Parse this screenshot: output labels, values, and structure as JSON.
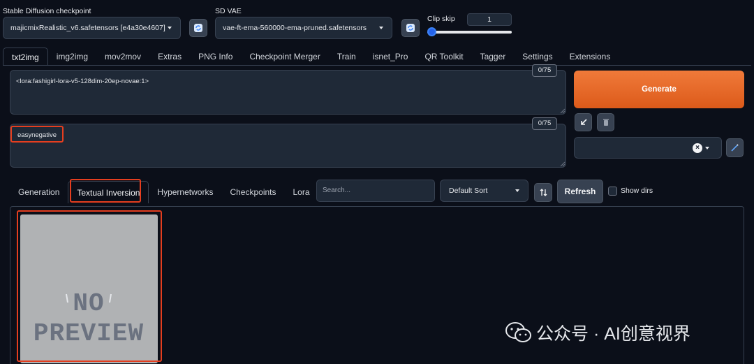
{
  "header": {
    "checkpoint_label": "Stable Diffusion checkpoint",
    "checkpoint_value": "majicmixRealistic_v6.safetensors [e4a30e4607]",
    "vae_label": "SD VAE",
    "vae_value": "vae-ft-ema-560000-ema-pruned.safetensors",
    "clip_skip_label": "Clip skip",
    "clip_skip_value": "1",
    "clip_skip_level": 0
  },
  "tabs": [
    {
      "label": "txt2img",
      "active": true
    },
    {
      "label": "img2img"
    },
    {
      "label": "mov2mov"
    },
    {
      "label": "Extras"
    },
    {
      "label": "PNG Info"
    },
    {
      "label": "Checkpoint Merger"
    },
    {
      "label": "Train"
    },
    {
      "label": "isnet_Pro"
    },
    {
      "label": "QR Toolkit"
    },
    {
      "label": "Tagger"
    },
    {
      "label": "Settings"
    },
    {
      "label": "Extensions"
    }
  ],
  "prompt": {
    "positive": "<lora:fashigirl-lora-v5-128dim-20ep-novae:1>",
    "positive_count": "0/75",
    "negative": "easynegative",
    "negative_count": "0/75"
  },
  "actions": {
    "generate_label": "Generate"
  },
  "extra_networks": {
    "tabs": [
      {
        "label": "Generation"
      },
      {
        "label": "Textual Inversion",
        "active": true
      },
      {
        "label": "Hypernetworks"
      },
      {
        "label": "Checkpoints"
      },
      {
        "label": "Lora"
      }
    ],
    "search_placeholder": "Search...",
    "sort_value": "Default Sort",
    "refresh_label": "Refresh",
    "show_dirs_label": "Show dirs",
    "preview_text_line1": "NO",
    "preview_text_line2": "PREVIEW"
  },
  "watermark": {
    "text": "公众号 · AI创意视界"
  },
  "colors": {
    "accent": "#e8692a",
    "highlight": "#e53e1f",
    "background": "#0b0f19"
  }
}
